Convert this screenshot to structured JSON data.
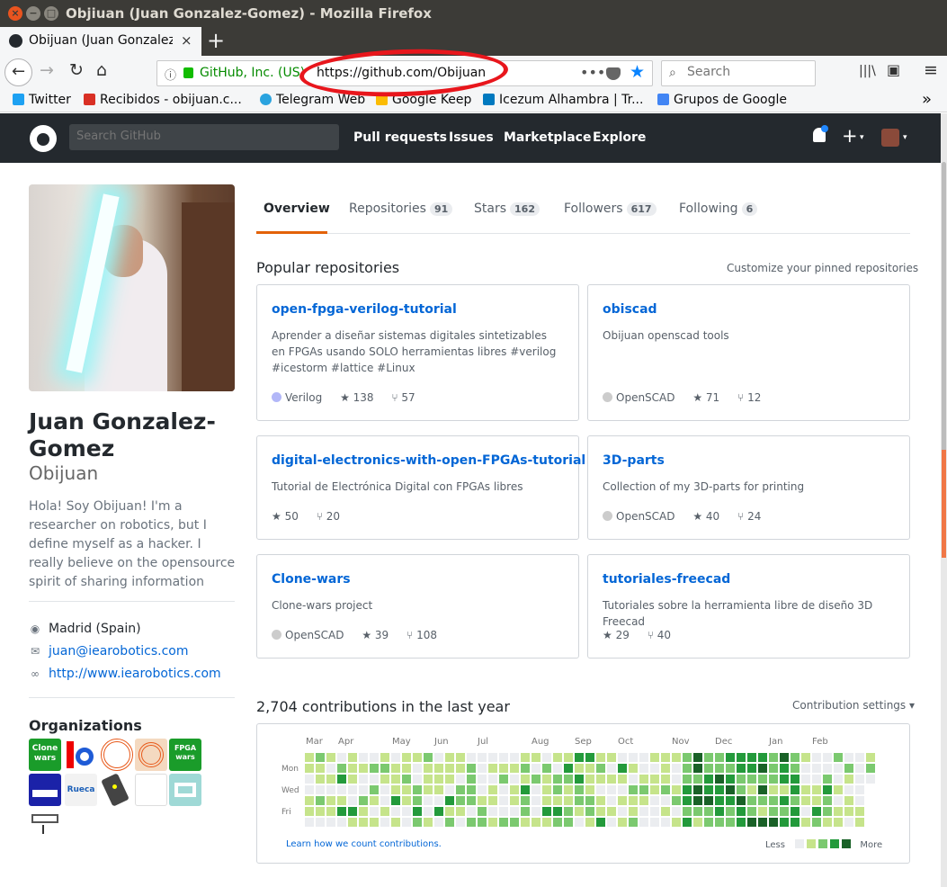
{
  "window": {
    "title": "Objiuan (Juan Gonzalez-Gomez) - Mozilla Firefox",
    "close_glyph": "×",
    "min_glyph": "−",
    "max_glyph": "□"
  },
  "browser": {
    "tab_title": "Obijuan (Juan Gonzalez-Gomez)",
    "tab_close": "×",
    "new_tab": "+",
    "back": "←",
    "forward": "→",
    "reload": "↻",
    "home": "⌂",
    "site_info": "ⓘ",
    "company": "GitHub, Inc. (US)",
    "url": "https://github.com/Obijuan",
    "page_actions": "•••",
    "search_placeholder": "Search",
    "library": "|||\\",
    "sidebar": "▣",
    "menu": "≡",
    "overflow": "»"
  },
  "bookmarks": [
    {
      "label": "Twitter",
      "color": "#1da1f2"
    },
    {
      "label": "Recibidos - obijuan.c...",
      "color": "#d93025"
    },
    {
      "label": "Telegram Web",
      "color": "#2aa3df"
    },
    {
      "label": "Google Keep",
      "color": "#fbbc04"
    },
    {
      "label": "Icezum Alhambra | Tr...",
      "color": "#0079bf"
    },
    {
      "label": "Grupos de Google",
      "color": "#4285f4"
    }
  ],
  "github_header": {
    "search_placeholder": "Search GitHub",
    "nav": [
      "Pull requests",
      "Issues",
      "Marketplace",
      "Explore"
    ],
    "plus": "+",
    "caret": "▾"
  },
  "profile": {
    "name": "Juan Gonzalez-Gomez",
    "login": "Obijuan",
    "bio": "Hola! Soy Obijuan! I'm a researcher on robotics, but I define myself as a hacker. I really believe on the opensource spirit of sharing information",
    "location": "Madrid (Spain)",
    "email": "juan@iearobotics.com",
    "website": "http://www.iearobotics.com",
    "orgs_title": "Organizations",
    "org_labels": [
      "Clone wars",
      "FPGA wars",
      "Rueca"
    ]
  },
  "tabs": [
    {
      "label": "Overview",
      "count": ""
    },
    {
      "label": "Repositories",
      "count": "91"
    },
    {
      "label": "Stars",
      "count": "162"
    },
    {
      "label": "Followers",
      "count": "617"
    },
    {
      "label": "Following",
      "count": "6"
    }
  ],
  "popular": {
    "title": "Popular repositories",
    "customize": "Customize your pinned repositories",
    "repos": [
      {
        "name": "open-fpga-verilog-tutorial",
        "description": "Aprender a diseñar sistemas digitales sintetizables en FPGAs usando SOLO herramientas libres #verilog #icestorm #lattice #Linux",
        "language": "Verilog",
        "lang_color": "#b2b7f8",
        "stars": "138",
        "forks": "57"
      },
      {
        "name": "obiscad",
        "description": "Obijuan openscad tools",
        "language": "OpenSCAD",
        "lang_color": "#cccccc",
        "stars": "71",
        "forks": "12"
      },
      {
        "name": "digital-electronics-with-open-FPGAs-tutorial",
        "description": "Tutorial de Electrónica Digital con FPGAs libres",
        "language": "",
        "lang_color": "",
        "stars": "50",
        "forks": "20"
      },
      {
        "name": "3D-parts",
        "description": "Collection of my 3D-parts for printing",
        "language": "OpenSCAD",
        "lang_color": "#cccccc",
        "stars": "40",
        "forks": "24"
      },
      {
        "name": "Clone-wars",
        "description": "Clone-wars project",
        "language": "OpenSCAD",
        "lang_color": "#cccccc",
        "stars": "39",
        "forks": "108"
      },
      {
        "name": "tutoriales-freecad",
        "description": "Tutoriales sobre la herramienta libre de diseño 3D Freecad",
        "language": "",
        "lang_color": "",
        "stars": "29",
        "forks": "40"
      }
    ],
    "star_glyph": "★",
    "fork_glyph": "⑂"
  },
  "contributions": {
    "title": "2,704 contributions in the last year",
    "settings": "Contribution settings ▾",
    "months": [
      "Mar",
      "Apr",
      "May",
      "Jun",
      "Jul",
      "Aug",
      "Sep",
      "Oct",
      "Nov",
      "Dec",
      "Jan",
      "Feb"
    ],
    "weekdays": [
      "Mon",
      "Wed",
      "Fri"
    ],
    "learn": "Learn how we count contributions.",
    "less": "Less",
    "more": "More",
    "colors": [
      "#ebedf0",
      "#c6e48b",
      "#7bc96f",
      "#239a3b",
      "#196127"
    ]
  }
}
